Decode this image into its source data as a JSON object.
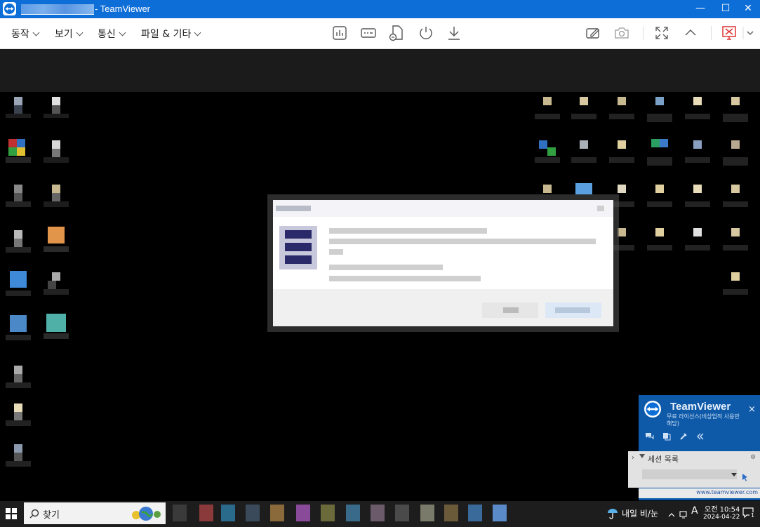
{
  "window": {
    "app_name": "- TeamViewer",
    "minimize_glyph": "—",
    "maximize_glyph": "☐",
    "close_glyph": "✕"
  },
  "menu": {
    "items": [
      {
        "label": "동작"
      },
      {
        "label": "보기"
      },
      {
        "label": "통신"
      },
      {
        "label": "파일 & 기타"
      }
    ]
  },
  "toolbar": {
    "icons": [
      "bar-chart-icon",
      "keyboard-icon",
      "file-transfer-icon",
      "power-icon",
      "download-icon",
      "draw-icon",
      "camera-icon",
      "fullscreen-icon",
      "collapse-up-icon",
      "end-session-icon",
      "menu-chevron-icon"
    ]
  },
  "panel": {
    "brand": "TeamViewer",
    "license_text": "무료 라이선스(비상업적 사용만 해당)",
    "close_glyph": "×",
    "session_label": "세션 목록",
    "link": "www.teamviewer.com"
  },
  "taskbar": {
    "search_placeholder": "찾기",
    "weather_text": "내일 비/눈",
    "ime": "A",
    "time": "오전 10:54",
    "date": "2024-04-22",
    "notification_count": "1"
  },
  "colors": {
    "titlebar": "#0e6ed8",
    "panel": "#0f5aa8",
    "taskbar": "#1d1d1d"
  }
}
